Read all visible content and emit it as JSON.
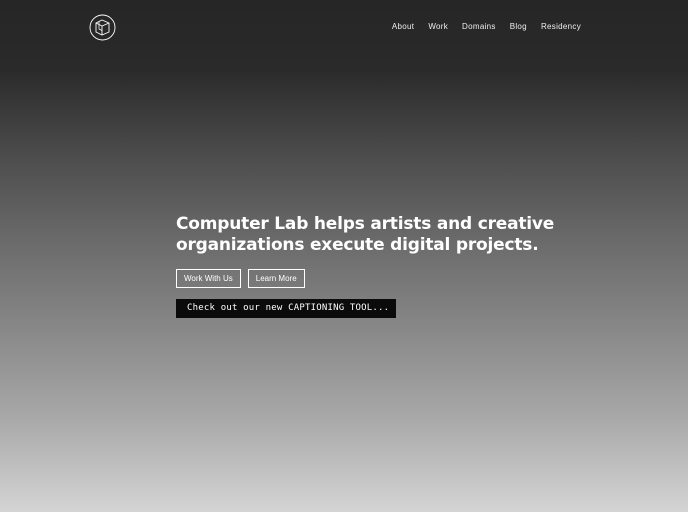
{
  "header": {
    "logo_icon": "cube-in-circle-logo",
    "nav": [
      {
        "label": "About"
      },
      {
        "label": "Work"
      },
      {
        "label": "Domains"
      },
      {
        "label": "Blog"
      },
      {
        "label": "Residency"
      }
    ]
  },
  "hero": {
    "headline_line1": "Computer Lab helps artists and creative",
    "headline_line2": "organizations execute digital projects.",
    "primary_button": "Work With Us",
    "secondary_button": "Learn More",
    "promo_text": "Check out our new CAPTIONING TOOL..."
  },
  "colors": {
    "text": "#ffffff",
    "promo_background": "#0b0b0b",
    "gradient_top": "#262626",
    "gradient_bottom": "#d4d4d4"
  }
}
